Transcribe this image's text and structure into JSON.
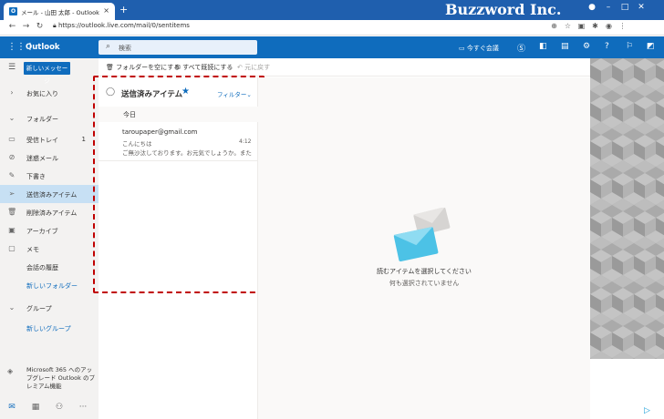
{
  "browser": {
    "tab_title": "メール - 山田 太郎 - Outlook",
    "tab_favicon": "O",
    "tab_close": "×",
    "new_tab": "+",
    "brand_text": "Buzzword Inc.",
    "url": "https://outlook.live.com/mail/0/sentitems"
  },
  "header": {
    "app_name": "Outlook",
    "search_placeholder": "検索",
    "meet_now": "今すぐ会議"
  },
  "sidebar": {
    "new_message": "新しいメッセージ",
    "favorites": "お気に入り",
    "folders_header": "フォルダー",
    "items": [
      {
        "label": "受信トレイ",
        "count": "1",
        "icon": "inbox-icon"
      },
      {
        "label": "迷惑メール",
        "count": "",
        "icon": "blocked-icon"
      },
      {
        "label": "下書き",
        "count": "",
        "icon": "pencil-icon"
      },
      {
        "label": "送信済みアイテム",
        "count": "",
        "icon": "send-icon"
      },
      {
        "label": "削除済みアイテム",
        "count": "",
        "icon": "trash-icon"
      },
      {
        "label": "アーカイブ",
        "count": "",
        "icon": "archive-icon"
      },
      {
        "label": "メモ",
        "count": "",
        "icon": "note-icon"
      },
      {
        "label": "会話の履歴",
        "count": "",
        "icon": ""
      }
    ],
    "new_folder": "新しいフォルダー",
    "groups_header": "グループ",
    "new_group": "新しいグループ",
    "promo": "Microsoft 365 へのアップグレード Outlook のプレミアム機能"
  },
  "toolbar": {
    "empty_folder": "フォルダーを空にする",
    "mark_all_read": "すべて既読にする",
    "undo": "元に戻す"
  },
  "message_list": {
    "title": "送信済みアイテム",
    "filter": "フィルター",
    "group_label": "今日",
    "messages": [
      {
        "from": "taroupaper@gmail.com",
        "subject": "こんにちは",
        "time": "4:12",
        "preview": "ご無沙汰しております。お元気でしょうか。また近..."
      }
    ]
  },
  "reading_pane": {
    "main_text": "読むアイテムを選択してください",
    "sub_text": "何も選択されていません"
  },
  "colors": {
    "brand_blue": "#0f6cbd",
    "chrome_bar": "#1f5fae",
    "selected_row": "#c7e0f4",
    "highlight_border": "#c00000"
  }
}
